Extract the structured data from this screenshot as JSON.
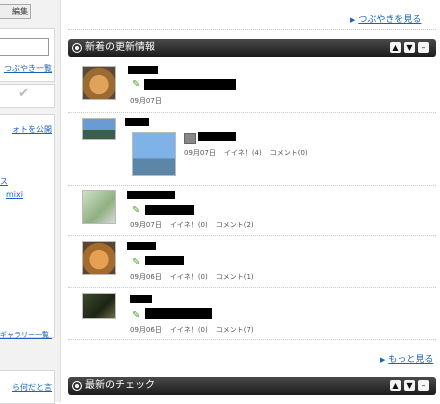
{
  "left": {
    "edit_label": "編集",
    "link_tweet_list": "つぶやき一覧",
    "link_photo_public": "ォトを公開",
    "link_su": "ス",
    "link_mixi": "mixi",
    "link_gallery_manage": "ギャラリー一覧・管理",
    "link_bottom": "ら何だと言"
  },
  "main": {
    "see_tweets": "つぶやきを見る",
    "news_title": "新着の更新情報",
    "more": "もっと見る",
    "check_title": "最新のチェック",
    "ctrl_up": "▲",
    "ctrl_down": "▼",
    "ctrl_min": "–"
  },
  "entries": [
    {
      "date": "09月07日",
      "likes": "",
      "comments": "",
      "thumb": "cat"
    },
    {
      "date": "09月07日",
      "likes": "イイネ！(4)",
      "comments": "コメント(0)",
      "thumb": "person"
    },
    {
      "date": "09月07日",
      "likes": "イイネ！(0)",
      "comments": "コメント(2)",
      "thumb": "tree"
    },
    {
      "date": "09月06日",
      "likes": "イイネ！(0)",
      "comments": "コメント(1)",
      "thumb": "cat"
    },
    {
      "date": "09月06日",
      "likes": "イイネ！(0)",
      "comments": "コメント(7)",
      "thumb": "dark"
    }
  ],
  "colors": {
    "link": "#1a63b8",
    "bar": "#262626",
    "pencil": "#4aa02c"
  }
}
